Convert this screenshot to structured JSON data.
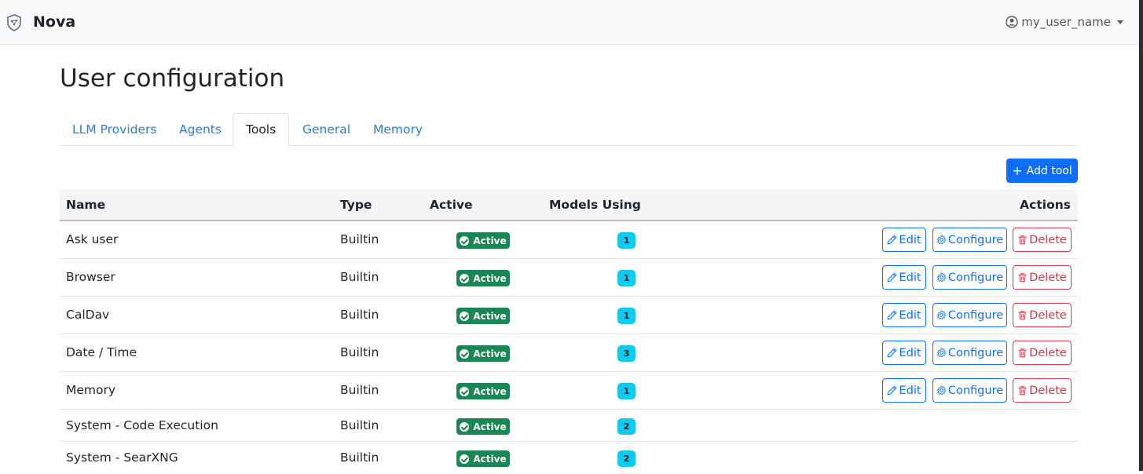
{
  "navbar": {
    "brand": "Nova",
    "user": "my_user_name"
  },
  "page": {
    "title": "User configuration"
  },
  "tabs": [
    {
      "label": "LLM Providers",
      "active": false
    },
    {
      "label": "Agents",
      "active": false
    },
    {
      "label": "Tools",
      "active": true
    },
    {
      "label": "General",
      "active": false
    },
    {
      "label": "Memory",
      "active": false
    }
  ],
  "toolbar": {
    "add_label": "Add tool"
  },
  "table": {
    "headers": {
      "name": "Name",
      "type": "Type",
      "active": "Active",
      "models": "Models Using",
      "actions": "Actions"
    },
    "rows": [
      {
        "name": "Ask user",
        "type": "Builtin",
        "status": "Active",
        "models": "1",
        "actions": true
      },
      {
        "name": "Browser",
        "type": "Builtin",
        "status": "Active",
        "models": "1",
        "actions": true
      },
      {
        "name": "CalDav",
        "type": "Builtin",
        "status": "Active",
        "models": "1",
        "actions": true
      },
      {
        "name": "Date / Time",
        "type": "Builtin",
        "status": "Active",
        "models": "3",
        "actions": true
      },
      {
        "name": "Memory",
        "type": "Builtin",
        "status": "Active",
        "models": "1",
        "actions": true
      },
      {
        "name": "System - Code Execution",
        "type": "Builtin",
        "status": "Active",
        "models": "2",
        "actions": false
      },
      {
        "name": "System - SearXNG",
        "type": "Builtin",
        "status": "Active",
        "models": "2",
        "actions": false
      }
    ],
    "action_labels": {
      "edit": "Edit",
      "configure": "Configure",
      "delete": "Delete"
    }
  },
  "colors": {
    "primary": "#0d6efd",
    "success": "#198754",
    "info": "#0dcaf0",
    "danger": "#dc3545"
  }
}
